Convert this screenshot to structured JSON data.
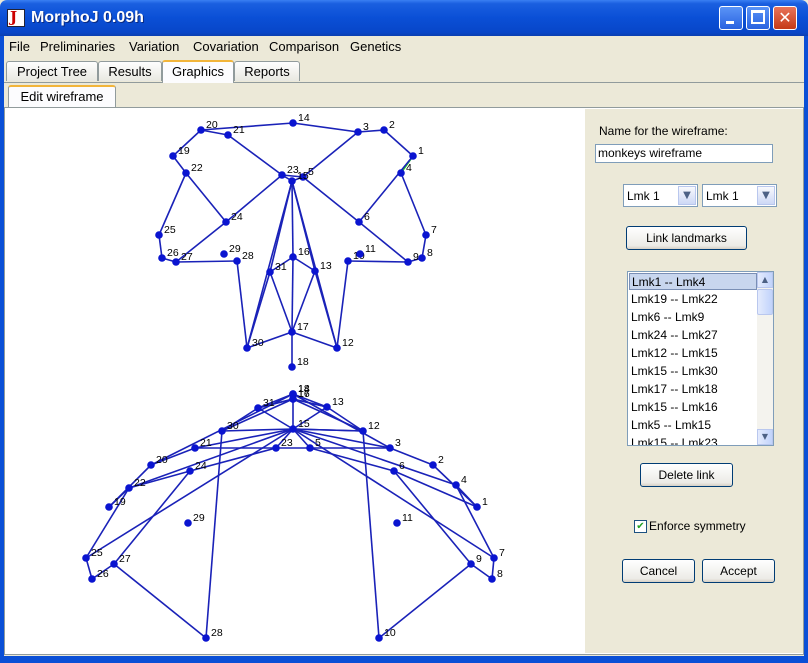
{
  "window": {
    "title": "MorphoJ 0.09h"
  },
  "menu": [
    "File",
    "Preliminaries",
    "Variation",
    "Covariation",
    "Comparison",
    "Genetics"
  ],
  "tabs": [
    "Project Tree",
    "Results",
    "Graphics",
    "Reports"
  ],
  "active_tab": "Graphics",
  "subtab": "Edit wireframe",
  "side": {
    "name_label": "Name for the wireframe:",
    "name_value": "monkeys wireframe",
    "combo1": "Lmk 1",
    "combo2": "Lmk 1",
    "link_button": "Link landmarks",
    "links": [
      "Lmk1 -- Lmk4",
      "Lmk19 -- Lmk22",
      "Lmk6 -- Lmk9",
      "Lmk24 -- Lmk27",
      "Lmk12 -- Lmk15",
      "Lmk15 -- Lmk30",
      "Lmk17 -- Lmk18",
      "Lmk15 -- Lmk16",
      "Lmk5 -- Lmk15",
      "Lmk15 -- Lmk23"
    ],
    "selected_link": "Lmk1 -- Lmk4",
    "delete_button": "Delete link",
    "symmetry_label": "Enforce symmetry",
    "symmetry_checked": true,
    "cancel_button": "Cancel",
    "accept_button": "Accept"
  },
  "colors": {
    "wire": "#1a22b8",
    "landmark": "#0a14d0",
    "highlight": "#22cc22"
  }
}
